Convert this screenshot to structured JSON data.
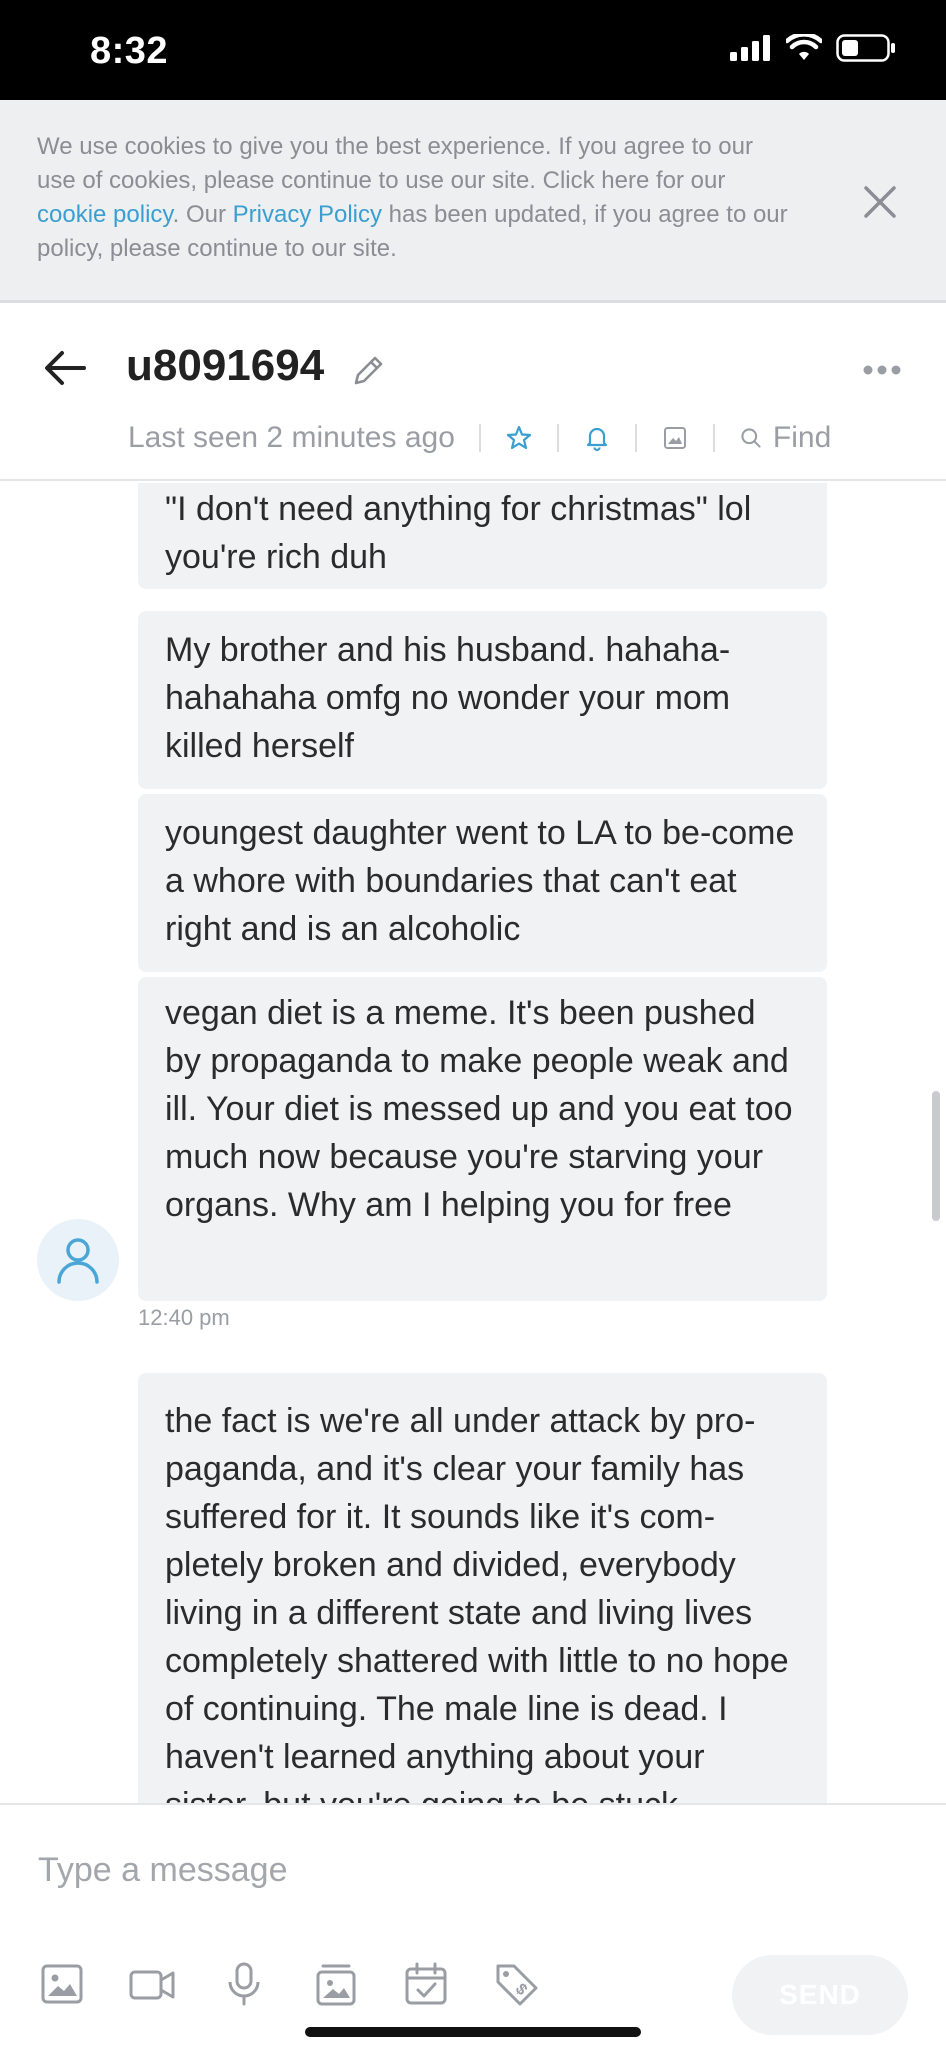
{
  "status_bar": {
    "time": "8:32"
  },
  "cookie_banner": {
    "text_before": "We use cookies to give you the best experience. If you agree to our use of cookies, please continue to use our site. Click here for our ",
    "cookie_link": "cookie policy",
    "text_middle": ". Our ",
    "privacy_link": "Privacy Policy",
    "text_after": " has been updated, if you agree to our policy, please continue to our site."
  },
  "header": {
    "title": "u8091694",
    "last_seen": "Last seen 2 minutes ago",
    "find_label": "Find"
  },
  "messages": [
    {
      "text": "\"I don't need anything for christmas\" lol you're rich duh"
    },
    {
      "text": "My brother and his husband. hahaha-hahahaha omfg no wonder your mom killed herself"
    },
    {
      "text": "youngest daughter went to LA to be-come a whore with boundaries that can't eat right and is an alcoholic"
    },
    {
      "text": "vegan diet is a meme. It's been pushed by propaganda to make people weak and ill. Your diet is messed up and you eat too much now because you're starving your organs. Why am I helping you for free"
    },
    {
      "text": "the fact is we're all under attack by pro-paganda, and it's clear your family has suffered for it. It sounds like it's com-pletely broken and divided, everybody living in a different state and living lives completely shattered with little to no hope of continuing. The male line is dead. I haven't learned anything about your sister, but you're going to be stuck"
    }
  ],
  "timestamp": "12:40 pm",
  "composer": {
    "placeholder": "Type a message",
    "send_label": "SEND"
  },
  "colors": {
    "accent": "#3a9fd0",
    "bubble": "#f1f2f4",
    "muted": "#9a9da3"
  }
}
